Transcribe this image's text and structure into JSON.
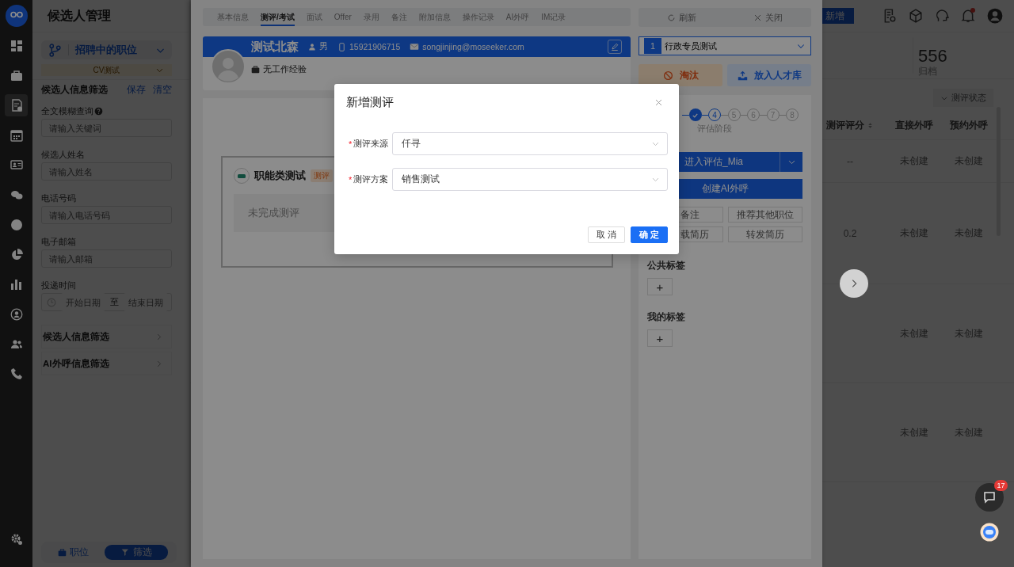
{
  "nav": {
    "items": [
      {
        "selected": false
      },
      {
        "selected": false
      },
      {
        "selected": true
      },
      {
        "selected": false
      },
      {
        "selected": false
      },
      {
        "selected": false
      },
      {
        "selected": false
      },
      {
        "selected": false
      },
      {
        "selected": false
      },
      {
        "selected": false
      },
      {
        "selected": false
      },
      {
        "selected": false
      }
    ]
  },
  "page_title": "候选人管理",
  "job_filter": {
    "value": "招聘中的职位",
    "sub_value": "CV测试"
  },
  "filter": {
    "title": "候选人信息筛选",
    "actions": [
      "保存",
      "清空"
    ],
    "fields": [
      {
        "kind": "text",
        "label": "全文模糊查询",
        "help": true,
        "placeholder": "请输入关键词"
      },
      {
        "kind": "text",
        "label": "候选人姓名",
        "help": false,
        "placeholder": "请输入姓名"
      },
      {
        "kind": "text",
        "label": "电话号码",
        "help": false,
        "placeholder": "请输入电话号码"
      },
      {
        "kind": "text",
        "label": "电子邮箱",
        "help": false,
        "placeholder": "请输入邮箱"
      },
      {
        "kind": "date_range",
        "label": "投递时间",
        "help": false,
        "start_placeholder": "开始日期",
        "separator": "至",
        "end_placeholder": "结束日期"
      }
    ],
    "sections": [
      {
        "label": "候选人信息筛选",
        "expanded": false
      },
      {
        "label": "AI外呼信息筛选",
        "expanded": false
      }
    ]
  },
  "view_switch": [
    {
      "label": "职位",
      "selected": false
    },
    {
      "label": "筛选",
      "selected": true
    }
  ],
  "header": {
    "add_button": "新增",
    "notification": true
  },
  "stats": [
    {
      "value": "556",
      "label": "归档"
    }
  ],
  "table": {
    "filter_button": "测评状态",
    "columns": [
      {
        "label": "测评评分",
        "sortable": true
      },
      {
        "label": "直接外呼",
        "sortable": false
      },
      {
        "label": "预约外呼",
        "sortable": false
      }
    ],
    "rows": [
      {
        "score": "--",
        "direct_call": "未创建",
        "scheduled_call": "未创建"
      },
      {
        "score": "0.2",
        "direct_call": "未创建",
        "scheduled_call": "未创建"
      },
      {
        "direct_call": "未创建",
        "scheduled_call": "未创建"
      },
      {
        "direct_call": "未创建",
        "scheduled_call": "未创建"
      }
    ]
  },
  "drawer": {
    "tabs": [
      {
        "label": "基本信息",
        "selected": false
      },
      {
        "label": "测评/考试",
        "selected": true
      },
      {
        "label": "面试",
        "selected": false
      },
      {
        "label": "Offer",
        "selected": false
      },
      {
        "label": "录用",
        "selected": false
      },
      {
        "label": "备注",
        "selected": false
      },
      {
        "label": "附加信息",
        "selected": false
      },
      {
        "label": "操作记录",
        "selected": false
      },
      {
        "label": "AI外呼",
        "selected": false
      },
      {
        "label": "IM记录",
        "selected": false
      }
    ],
    "toolbar": [
      {
        "kind": "refresh",
        "label": "刷新"
      },
      {
        "kind": "close",
        "label": "关闭"
      }
    ],
    "candidate": {
      "name": "测试北森",
      "gender": "男",
      "phone": "15921906715",
      "email": "songjinjing@moseeker.com",
      "experience": "无工作经验"
    },
    "assessments": [
      {
        "title": "职能类测试",
        "tag": "测评",
        "status": "未完成测评"
      }
    ],
    "stage_select": {
      "index": "1",
      "value": "行政专员测试"
    },
    "actions": [
      {
        "kind": "reject",
        "label": "淘汰"
      },
      {
        "kind": "talent_pool",
        "label": "放入人才库"
      }
    ],
    "steps": [
      {
        "done": true,
        "current": false
      },
      {
        "done": false,
        "current": true,
        "number": "4",
        "caption": "评估阶段"
      },
      {
        "done": false,
        "current": false,
        "number": "5"
      },
      {
        "done": false,
        "current": false,
        "number": "6"
      },
      {
        "done": false,
        "current": false,
        "number": "7"
      },
      {
        "done": false,
        "current": false,
        "number": "8"
      }
    ],
    "primary_buttons": [
      {
        "label": "进入评估_Mia",
        "split": true
      },
      {
        "label": "创建AI外呼",
        "split": false
      }
    ],
    "secondary_buttons": [
      {
        "kind": "cut",
        "label": "备注"
      },
      {
        "kind": "full",
        "label": "推荐其他职位"
      },
      {
        "kind": "cut",
        "label": "载简历"
      },
      {
        "kind": "full",
        "label": "转发简历"
      }
    ],
    "tag_groups": [
      {
        "title": "公共标签",
        "add": "+"
      },
      {
        "title": "我的标签",
        "add": "+"
      }
    ]
  },
  "modal": {
    "title": "新增测评",
    "fields": [
      {
        "marker": "*",
        "label": "测评来源",
        "value": "仟寻"
      },
      {
        "marker": "*",
        "label": "测评方案",
        "value": "销售测试"
      }
    ],
    "buttons": [
      {
        "label": "取 消",
        "primary": false
      },
      {
        "label": "确 定",
        "primary": true
      }
    ]
  },
  "chat": {
    "badge": "17"
  }
}
